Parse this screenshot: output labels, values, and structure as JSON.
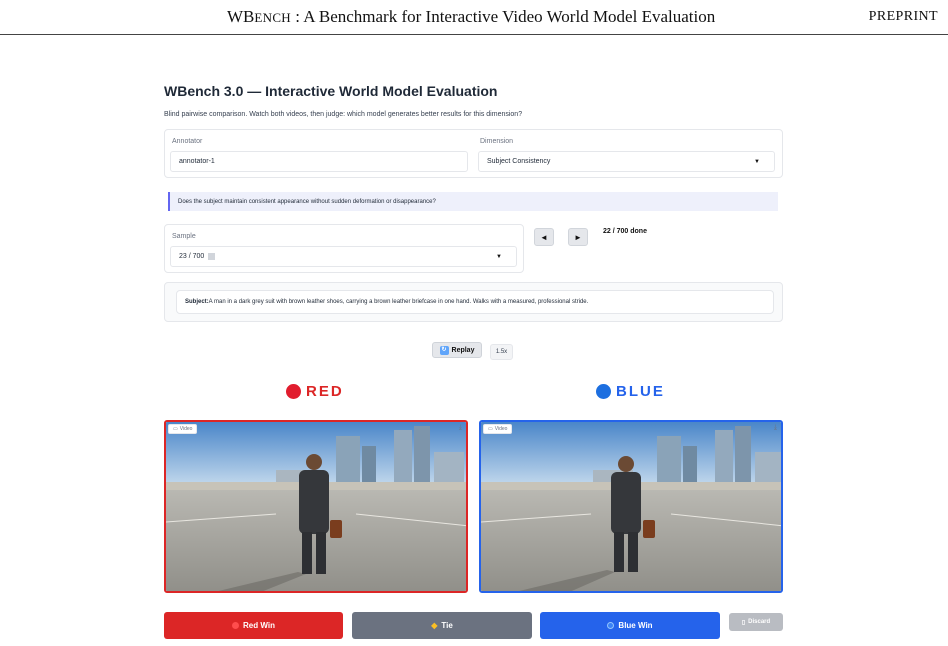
{
  "paper_header": {
    "title_cap": "WB",
    "title_smallcaps": "ENCH",
    "title_rest": " : A Benchmark for Interactive Video World Model Evaluation",
    "tag": "PREPRINT"
  },
  "app": {
    "title": "WBench 3.0 — Interactive World Model Evaluation",
    "subtitle": "Blind pairwise comparison. Watch both videos, then judge: which model generates better results for this dimension?",
    "annotator": {
      "label": "Annotator",
      "value": "annotator-1"
    },
    "dimension": {
      "label": "Dimension",
      "value": "Subject Consistency"
    },
    "question": "Does the subject maintain consistent appearance without sudden deformation or disappearance?",
    "sample": {
      "label": "Sample",
      "value": "23 / 700"
    },
    "nav": {
      "prev": "◄",
      "next": "►",
      "progress": "22 / 700 done"
    },
    "subject": {
      "label": "Subject:",
      "text": " A man in a dark grey suit with brown leather shoes, carrying a brown leather briefcase in one hand. Walks with a measured, professional stride."
    },
    "playback": {
      "replay_label": "Replay",
      "speed": "1.5x"
    },
    "red": {
      "label": "RED",
      "color": "#dc2626",
      "video_tag": "Video"
    },
    "blue": {
      "label": "BLUE",
      "color": "#2563eb",
      "video_tag": "Video"
    },
    "actions": {
      "red_win": "Red Win",
      "tie": "Tie",
      "blue_win": "Blue Win",
      "discard": "Discard"
    }
  },
  "colors": {
    "red": "#dc2626",
    "gray": "#6b7280",
    "blue": "#2563eb",
    "discard": "#b9bcc2",
    "accent": "#6366f1"
  }
}
